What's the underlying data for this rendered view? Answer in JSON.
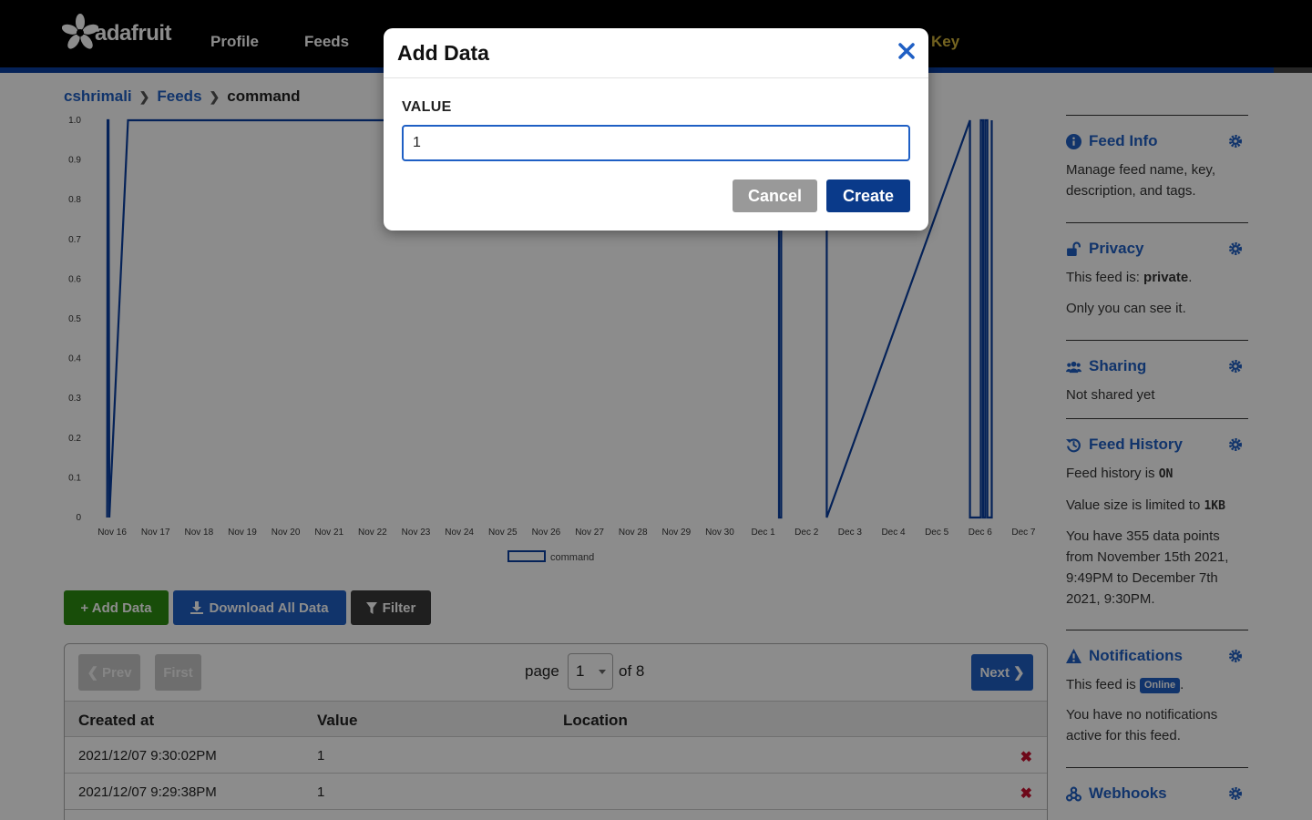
{
  "nav": {
    "logo_text": "adafruit",
    "links": [
      "Profile",
      "Feeds"
    ],
    "key_label": "Key"
  },
  "breadcrumb": [
    "cshrimali",
    "Feeds",
    "command"
  ],
  "chart_data": {
    "type": "line",
    "title": "",
    "xlabel": "",
    "ylabel": "",
    "ylim": [
      0,
      1.0
    ],
    "y_ticks": [
      "0",
      "0.1",
      "0.2",
      "0.3",
      "0.4",
      "0.5",
      "0.6",
      "0.7",
      "0.8",
      "0.9",
      "1.0"
    ],
    "x_ticks": [
      "Nov 16",
      "Nov 17",
      "Nov 18",
      "Nov 19",
      "Nov 20",
      "Nov 21",
      "Nov 22",
      "Nov 23",
      "Nov 24",
      "Nov 25",
      "Nov 26",
      "Nov 27",
      "Nov 28",
      "Nov 29",
      "Nov 30",
      "Dec 1",
      "Dec 2",
      "Dec 3",
      "Dec 4",
      "Dec 5",
      "Dec 6",
      "Dec 7"
    ],
    "grid": false,
    "legend_position": "bottom-center",
    "series": [
      {
        "name": "command",
        "color": "#0a3fa0",
        "x": [
          15.97,
          15.98,
          16.0,
          16.02,
          16.45,
          31.45,
          31.45,
          31.5,
          31.5,
          32.55,
          32.55,
          35.85,
          35.85,
          36.1,
          36.1,
          36.15,
          36.15,
          36.2,
          36.2,
          36.25,
          36.25,
          36.35,
          36.35
        ],
        "y": [
          0,
          1,
          1,
          0,
          1,
          1,
          0,
          0,
          1,
          1,
          0,
          1,
          0,
          0,
          1,
          1,
          0,
          0,
          1,
          1,
          0,
          0,
          1
        ]
      }
    ]
  },
  "actions": {
    "add_label": "+ Add Data",
    "download_label": "Download All Data",
    "filter_label": "Filter"
  },
  "pager": {
    "prev": "Prev",
    "first": "First",
    "page_word": "page",
    "page_value": "1",
    "of_text": "of 8",
    "next": "Next"
  },
  "table": {
    "headers": [
      "Created at",
      "Value",
      "Location"
    ],
    "rows": [
      {
        "created": "2021/12/07 9:30:02PM",
        "value": "1",
        "location": ""
      },
      {
        "created": "2021/12/07 9:29:38PM",
        "value": "1",
        "location": ""
      }
    ]
  },
  "sidebar": {
    "feed_info": {
      "title": "Feed Info",
      "text": "Manage feed name, key, description, and tags."
    },
    "privacy": {
      "title": "Privacy",
      "prefix": "This feed is: ",
      "state": "private",
      "suffix": ".",
      "text2": "Only you can see it."
    },
    "sharing": {
      "title": "Sharing",
      "text": "Not shared yet"
    },
    "history": {
      "title": "Feed History",
      "line1_prefix": "Feed history is ",
      "line1_value": "ON",
      "line2_prefix": "Value size is limited to ",
      "line2_value": "1KB",
      "text": "You have 355 data points from November 15th 2021, 9:49PM to December 7th 2021, 9:30PM."
    },
    "notifications": {
      "title": "Notifications",
      "prefix": "This feed is ",
      "badge": "Online",
      "suffix": ".",
      "text": "You have no notifications active for this feed."
    },
    "webhooks": {
      "title": "Webhooks"
    }
  },
  "modal": {
    "title": "Add Data",
    "field_label": "VALUE",
    "field_value": "1",
    "cancel": "Cancel",
    "create": "Create"
  }
}
